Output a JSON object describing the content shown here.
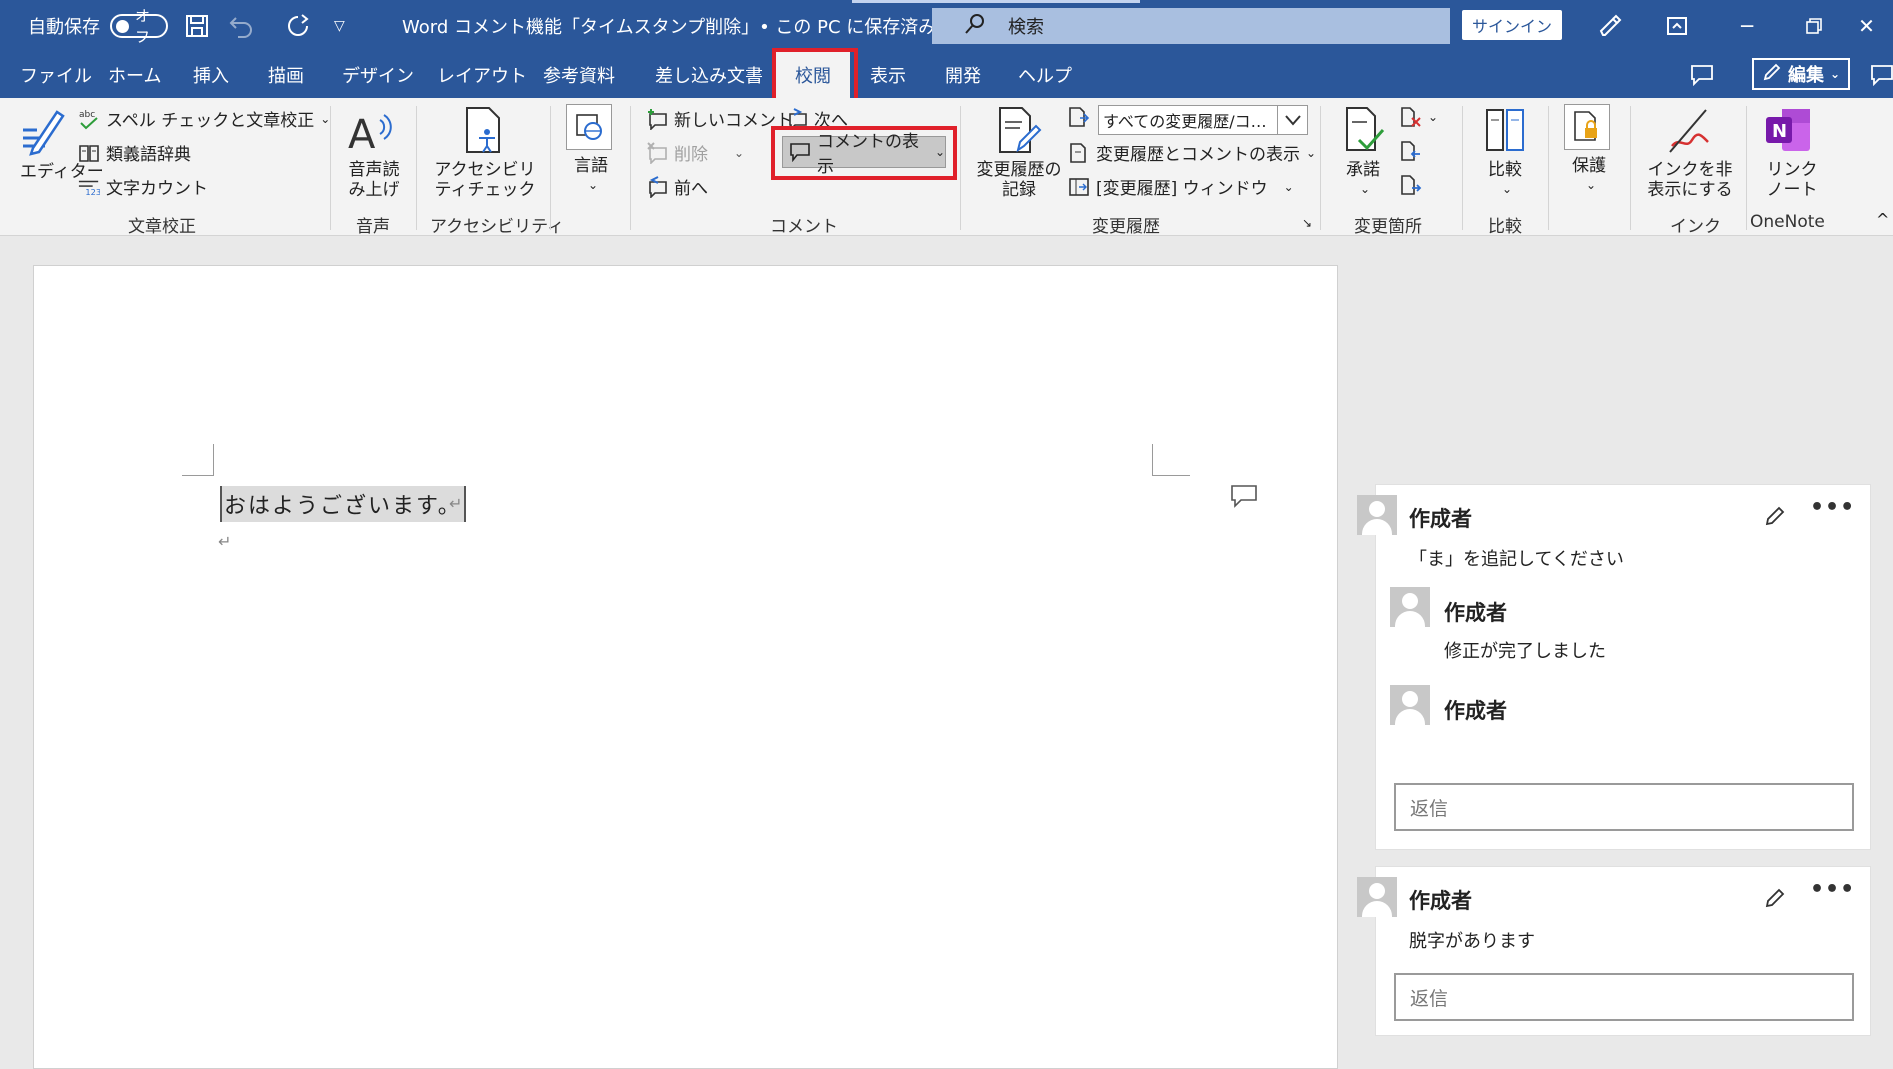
{
  "titlebar": {
    "autosave_label": "自動保存",
    "autosave_state": "オフ",
    "document_title": "Word コメント機能「タイムスタンプ削除」• この PC に保存済み",
    "search_placeholder": "検索",
    "signin_label": "サインイン"
  },
  "menu": {
    "tabs": [
      "ファイル",
      "ホーム",
      "挿入",
      "描画",
      "デザイン",
      "レイアウト",
      "参考資料",
      "差し込み文書",
      "校閲",
      "表示",
      "開発",
      "ヘルプ"
    ],
    "active_tab": "校閲",
    "edit_label": "編集"
  },
  "ribbon": {
    "proofing": {
      "editor": "エディター",
      "spell": "スペル チェックと文章校正",
      "thesaurus": "類義語辞典",
      "wordcount": "文字カウント",
      "group": "文章校正"
    },
    "speech": {
      "read_aloud": "音声読み上げ",
      "group": "音声"
    },
    "accessibility": {
      "check": "アクセシビリティチェック",
      "group": "アクセシビリティ"
    },
    "language": {
      "label": "言語"
    },
    "comments": {
      "new": "新しいコメント",
      "delete": "削除",
      "prev": "前へ",
      "next": "次へ",
      "show": "コメントの表示",
      "group": "コメント"
    },
    "tracking": {
      "track": "変更履歴の記録",
      "dropdown": "すべての変更履歴/コ…",
      "show_markup": "変更履歴とコメントの表示",
      "pane": "[変更履歴] ウィンドウ",
      "group": "変更履歴"
    },
    "changes": {
      "accept": "承諾",
      "group": "変更箇所"
    },
    "compare": {
      "label": "比較",
      "group": "比較"
    },
    "protect": {
      "label": "保護"
    },
    "ink": {
      "hide": "インクを非表示にする",
      "group": "インク"
    },
    "onenote": {
      "link": "リンクノート",
      "group": "OneNote"
    }
  },
  "document": {
    "text": "おはようございます。"
  },
  "comments": [
    {
      "author": "作成者",
      "text": "「ま」を追記してください",
      "replies": [
        {
          "author": "作成者",
          "text": "修正が完了しました"
        },
        {
          "author": "作成者",
          "text": ""
        }
      ],
      "reply_placeholder": "返信"
    },
    {
      "author": "作成者",
      "text": "脱字があります",
      "replies": [],
      "reply_placeholder": "返信"
    }
  ],
  "colors": {
    "titlebar": "#2b579a",
    "highlight": "#e0202a"
  }
}
